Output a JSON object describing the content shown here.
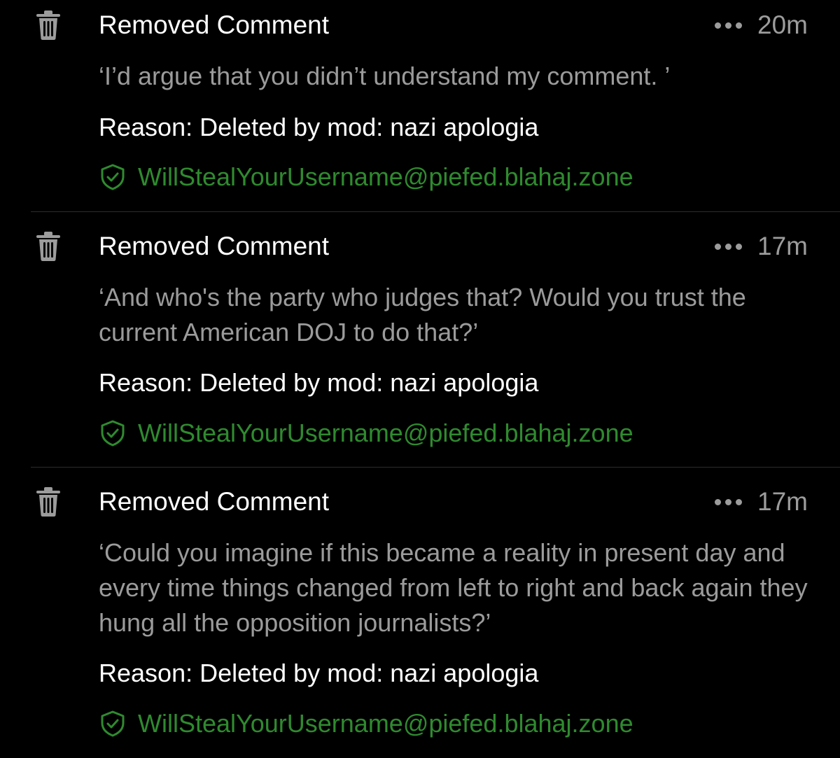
{
  "entries": [
    {
      "title": "Removed Comment",
      "time": "20m",
      "quote": "‘I’d argue that you didn’t understand my comment. ’",
      "reason": "Reason: Deleted by mod: nazi apologia",
      "moderator": "WillStealYourUsername@piefed.blahaj.zone",
      "icon": "trash-icon"
    },
    {
      "title": "Removed Comment",
      "time": "17m",
      "quote": "‘And who's the party who judges that? Would you trust the current American DOJ to do that?’",
      "reason": "Reason: Deleted by mod: nazi apologia",
      "moderator": "WillStealYourUsername@piefed.blahaj.zone",
      "icon": "trash-icon"
    },
    {
      "title": "Removed Comment",
      "time": "17m",
      "quote": "‘Could you imagine if this became a reality in present day and every time things changed from left to right and back again they hung all the opposition journalists?’",
      "reason": "Reason: Deleted by mod: nazi apologia",
      "moderator": "WillStealYourUsername@piefed.blahaj.zone",
      "icon": "trash-icon"
    }
  ],
  "colors": {
    "background": "#000000",
    "title": "#ffffff",
    "muted": "#9c9c9c",
    "moderator": "#2f8a2f",
    "divider": "#2c2c2c"
  }
}
